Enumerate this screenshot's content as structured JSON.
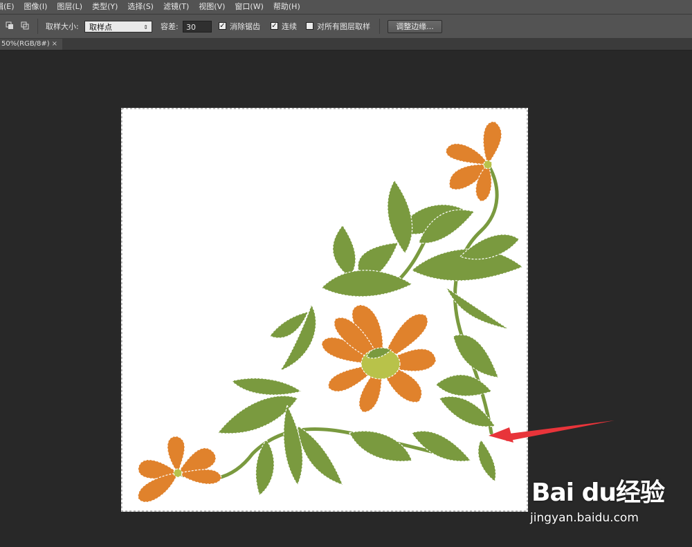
{
  "menu": {
    "items": [
      "辑(E)",
      "图像(I)",
      "图层(L)",
      "类型(Y)",
      "选择(S)",
      "滤镜(T)",
      "视图(V)",
      "窗口(W)",
      "帮助(H)"
    ]
  },
  "options": {
    "sample_size_label": "取样大小:",
    "sample_size_value": "取样点",
    "tolerance_label": "容差:",
    "tolerance_value": "30",
    "anti_alias_label": "消除锯齿",
    "anti_alias_checked": true,
    "contiguous_label": "连续",
    "contiguous_checked": true,
    "sample_all_layers_label": "对所有图层取样",
    "sample_all_layers_checked": false,
    "refine_edge_label": "调整边缘..."
  },
  "document_tab": {
    "label": "50%(RGB/8#)",
    "close": "×"
  },
  "colors": {
    "menubar": "#535353",
    "canvas": "#282828",
    "petal": "#e0822c",
    "leaf": "#7a9a3f",
    "annotation_arrow": "#e8343a"
  },
  "icons": {
    "new_selection": "new-selection-icon",
    "add_selection": "add-to-selection-icon",
    "arrow": "red-arrow-annotation"
  },
  "watermark": {
    "logo": "Bai du经验",
    "url": "jingyan.baidu.com"
  }
}
